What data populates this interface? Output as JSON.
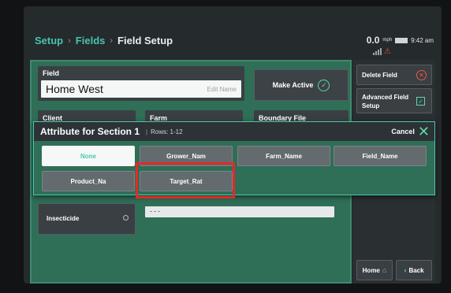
{
  "breadcrumb": {
    "items": [
      "Setup",
      "Fields",
      "Field Setup"
    ],
    "separator": "›"
  },
  "status": {
    "speed": "0.0",
    "speed_unit": "mph",
    "time": "9:42 am",
    "gps_warning_icon": "satellite-warning-icon"
  },
  "form": {
    "field_label": "Field",
    "field_value": "Home West",
    "field_edit_hint": "Edit Name",
    "make_active_label": "Make Active",
    "client_label": "Client",
    "farm_label": "Farm",
    "boundary_label": "Boundary File",
    "insecticide_label": "Insecticide",
    "lower_input_value": "---"
  },
  "side": {
    "delete_label": "Delete Field",
    "advanced_label_1": "Advanced Field",
    "advanced_label_2": "Setup",
    "home_label": "Home",
    "back_label": "Back"
  },
  "overlay": {
    "title": "Attribute for Section 1",
    "rows": "Rows: 1-12",
    "cancel_label": "Cancel",
    "options": [
      "None",
      "Grower_Nam",
      "Farm_Name",
      "Field_Name",
      "Product_Na",
      "Target_Rat"
    ],
    "selected": "None"
  },
  "colors": {
    "accent": "#49c9ac",
    "panel_green": "#2f6e57",
    "highlight_red": "#e12a26"
  }
}
